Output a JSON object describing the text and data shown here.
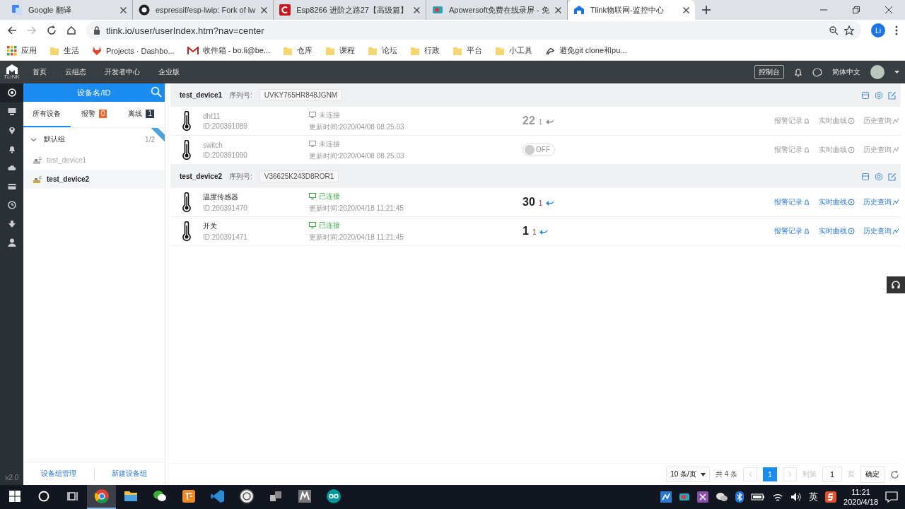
{
  "browser": {
    "tabs": [
      {
        "title": "Google 翻译",
        "kind": "translate",
        "selected": false
      },
      {
        "title": "espressif/esp-lwip: Fork of lw",
        "kind": "github",
        "selected": false
      },
      {
        "title": "Esp8266 进阶之路27【高级篇】",
        "kind": "csdn",
        "selected": false
      },
      {
        "title": "Apowersoft免费在线录屏 - 免",
        "kind": "recorder",
        "selected": false
      },
      {
        "title": "Tlink物联网-监控中心",
        "kind": "tlink",
        "selected": true
      }
    ],
    "url": "tlink.io/user/userIndex.htm?nav=center",
    "profile": "Li",
    "bookmarks": [
      {
        "label": "应用",
        "kind": "apps"
      },
      {
        "label": "生活",
        "kind": "folder"
      },
      {
        "label": "Projects · Dashbo...",
        "kind": "fox"
      },
      {
        "label": "收件箱 - bo.li@be...",
        "kind": "mail"
      },
      {
        "label": "仓库",
        "kind": "folder"
      },
      {
        "label": "课程",
        "kind": "folder"
      },
      {
        "label": "论坛",
        "kind": "folder"
      },
      {
        "label": "行政",
        "kind": "folder"
      },
      {
        "label": "平台",
        "kind": "folder"
      },
      {
        "label": "小工具",
        "kind": "folder"
      },
      {
        "label": "避免git clone和pu...",
        "kind": "script"
      }
    ]
  },
  "app": {
    "logo_text": "TLINK",
    "nav": [
      "首页",
      "云组态",
      "开发者中心",
      "企业版"
    ],
    "console_button": "控制台",
    "language": "简体中文"
  },
  "rail": [
    {
      "kind": "target",
      "selected": true
    },
    {
      "kind": "monitor",
      "selected": false
    },
    {
      "kind": "pin",
      "selected": false
    },
    {
      "kind": "bell",
      "selected": false
    },
    {
      "kind": "cloud",
      "selected": false
    },
    {
      "kind": "card",
      "selected": false
    },
    {
      "kind": "clock",
      "selected": false
    },
    {
      "kind": "download",
      "selected": false
    },
    {
      "kind": "user",
      "selected": false
    }
  ],
  "version": "v2.0",
  "sidebar": {
    "search_placeholder": "设备名/ID",
    "tabs": [
      {
        "label": "所有设备",
        "selected": true
      },
      {
        "label": "报警",
        "badge": "0",
        "color": "#f0642d",
        "selected": false
      },
      {
        "label": "离线",
        "badge": "1",
        "color": "#2f3a4a",
        "selected": false
      }
    ],
    "group": {
      "name": "默认组",
      "count": "1/2",
      "expanded": true,
      "children": [
        {
          "name": "test_device1",
          "online": false,
          "selected": false
        },
        {
          "name": "test_device2",
          "online": true,
          "selected": true
        }
      ]
    },
    "footer": [
      "设备组管理",
      "新建设备组"
    ]
  },
  "devices": [
    {
      "name": "test_device1",
      "serial_label": "序列号:",
      "serial": "UVKY765HR848JGNM",
      "sensors": [
        {
          "name": "dht11",
          "id": "ID:200391089",
          "status": "未连接",
          "connected": false,
          "updated": "更新时间:2020/04/08 08.25.03",
          "kind": "number",
          "value": "22",
          "unit": "1",
          "links": [
            "报警记录",
            "实时曲线",
            "历史查询"
          ]
        },
        {
          "name": "switch",
          "id": "ID:200391090",
          "status": "未连接",
          "connected": false,
          "updated": "更新时间:2020/04/08 08.25.03",
          "kind": "switch",
          "on": false,
          "value": "OFF",
          "links": [
            "报警记录",
            "实时曲线",
            "历史查询"
          ]
        }
      ]
    },
    {
      "name": "test_device2",
      "serial_label": "序列号:",
      "serial": "V36625K243D8ROR1",
      "sensors": [
        {
          "name": "温度传感器",
          "id": "ID:200391470",
          "status": "已连接",
          "connected": true,
          "updated": "更新时间:2020/04/18 11:21:45",
          "kind": "number",
          "value": "30",
          "unit": "1",
          "links": [
            "报警记录",
            "实时曲线",
            "历史查询"
          ]
        },
        {
          "name": "开关",
          "id": "ID:200391471",
          "status": "已连接",
          "connected": true,
          "updated": "更新时间:2020/04/18 11:21:45",
          "kind": "number",
          "value": "1",
          "unit": "1",
          "links": [
            "报警记录",
            "实时曲线",
            "历史查询"
          ]
        }
      ]
    }
  ],
  "pagination": {
    "page_size": "10 条/页",
    "total": "共 4 条",
    "pages": [
      {
        "label": "1",
        "selected": true
      }
    ],
    "goto_label": "到第",
    "goto_value": "1",
    "page_label": "页",
    "confirm": "确定"
  },
  "taskbar": {
    "apps": [
      {
        "kind": "chrome",
        "selected": true
      },
      {
        "kind": "explorer",
        "selected": false
      },
      {
        "kind": "wechat",
        "selected": false
      },
      {
        "kind": "orange",
        "selected": false
      },
      {
        "kind": "vscode",
        "selected": false
      },
      {
        "kind": "seal",
        "selected": false
      },
      {
        "kind": "blocks",
        "selected": false
      },
      {
        "kind": "m",
        "selected": false
      },
      {
        "kind": "arduino",
        "selected": false
      }
    ],
    "ime": "英",
    "time": "11:21",
    "date": "2020/4/18"
  }
}
